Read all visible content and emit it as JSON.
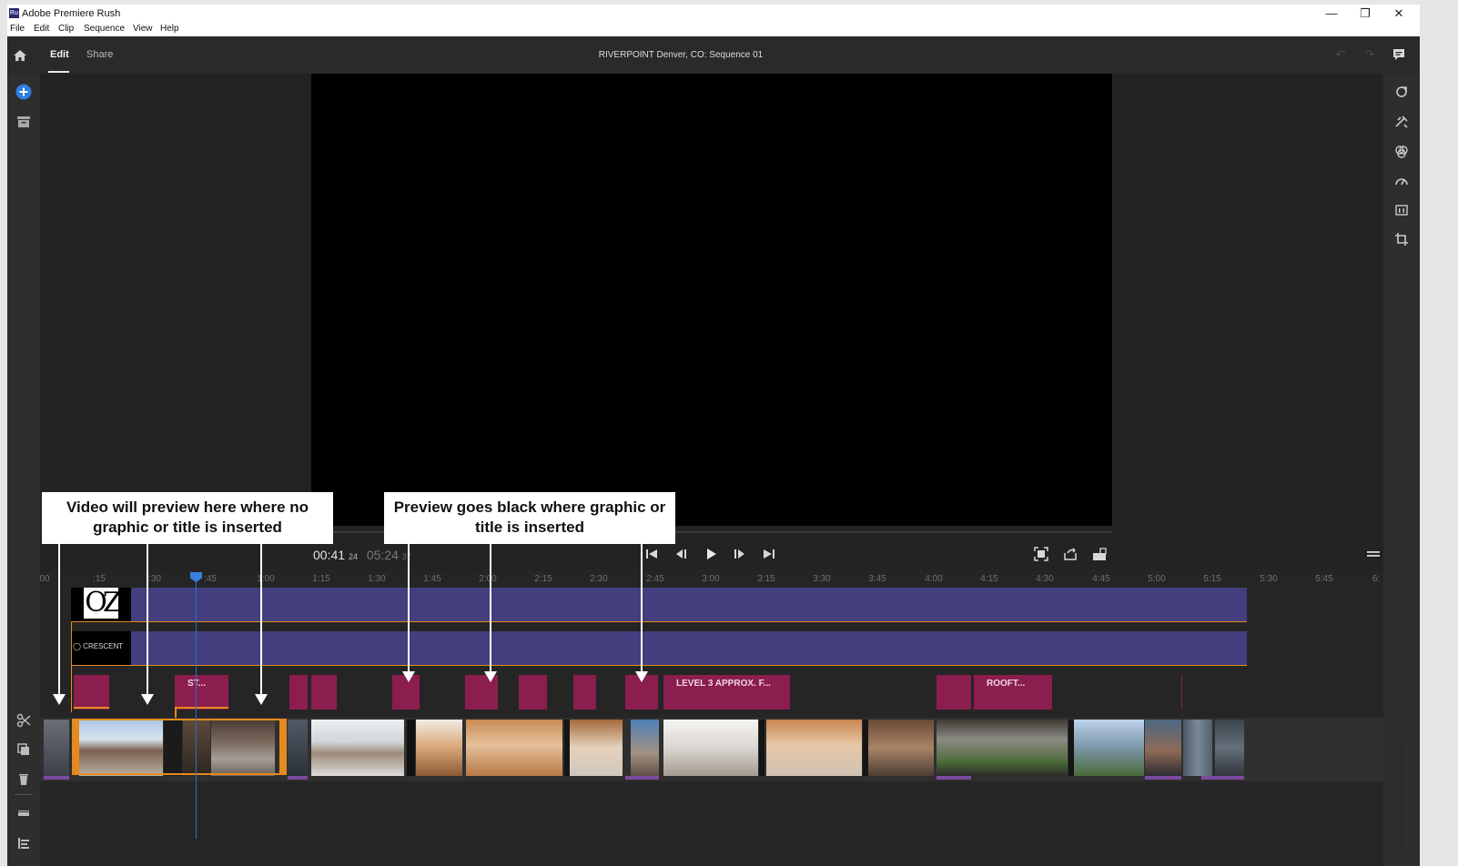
{
  "app": {
    "icon_text": "Ru",
    "window_title": "Adobe Premiere Rush"
  },
  "window_controls": {
    "minimize": "—",
    "restore": "❐",
    "close": "✕"
  },
  "menu": [
    "File",
    "Edit",
    "Clip",
    "Sequence",
    "View",
    "Help"
  ],
  "header": {
    "tabs": [
      {
        "label": "Edit",
        "active": true
      },
      {
        "label": "Share",
        "active": false
      }
    ],
    "sequence_title": "RIVERPOINT Denver, CO: Sequence 01",
    "undo": "↶",
    "redo": "↷"
  },
  "left_toolbar": [
    "add-media-icon",
    "archive-icon"
  ],
  "right_toolbar": [
    "transitions-icon",
    "effects-icon",
    "color-icon",
    "speed-icon",
    "audio-icon",
    "transform-icon"
  ],
  "player": {
    "current_time": "00:41",
    "current_frames": "24",
    "duration": "05:24",
    "duration_frames": "37"
  },
  "timeline": {
    "ruler_labels": [
      "00",
      ":15",
      ":30",
      ":45",
      "1:00",
      "1:15",
      "1:30",
      "1:45",
      "2:00",
      "2:15",
      "2:30",
      "2:45",
      "3:00",
      "3:15",
      "3:30",
      "3:45",
      "4:00",
      "4:15",
      "4:30",
      "4:45",
      "5:00",
      "5:15",
      "5:30",
      "5:45",
      "6:"
    ],
    "graphic_tracks": [
      {
        "thumb_text": "OZ"
      },
      {
        "thumb_text": "◯ CRESCENT"
      }
    ],
    "title_clips": [
      "",
      "ST...",
      "",
      "",
      "",
      "",
      "",
      "",
      "",
      "LEVEL 3 APPROX. F...",
      "",
      "ROOFT..."
    ]
  },
  "annotations": {
    "left_callout": "Video will preview here where no graphic or title is inserted",
    "right_callout": "Preview goes black where graphic or title is inserted"
  },
  "colors": {
    "accent_orange": "#e68a1e",
    "graphic_track": "#433f7e",
    "title_clip": "#8b1e4f",
    "playhead": "#3a7ee0",
    "preview_bg": "#000000"
  }
}
